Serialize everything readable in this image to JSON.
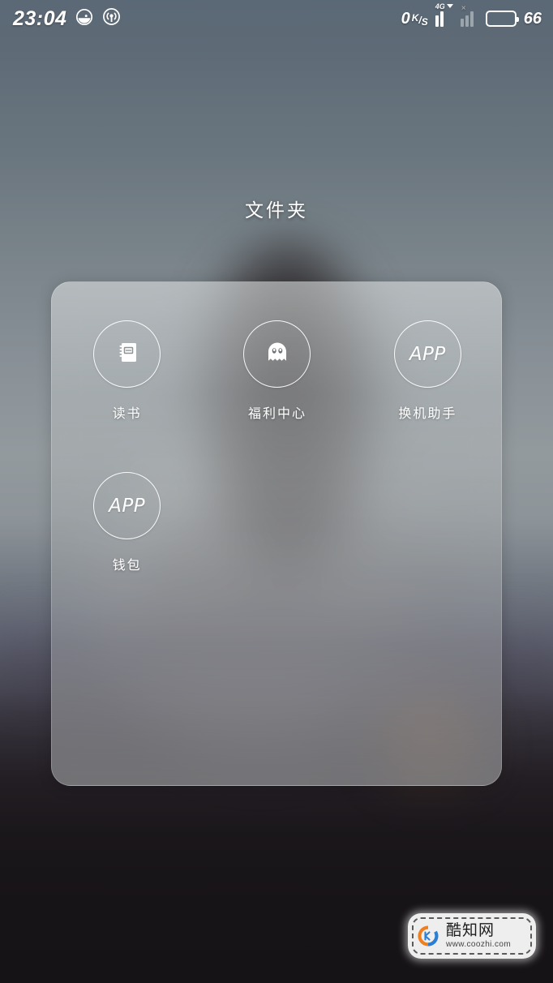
{
  "status_bar": {
    "time": "23:04",
    "icons": [
      {
        "name": "dnd-icon",
        "glyph": "do-not-disturb"
      },
      {
        "name": "hotspot-icon",
        "glyph": "personal-hotspot"
      }
    ],
    "network_speed": {
      "value": "0",
      "unit_top": "K",
      "unit_slash": "/",
      "unit_bottom": "S"
    },
    "sim1": {
      "label": "4G",
      "bars": 4
    },
    "sim2": {
      "label": "×",
      "bars": 4
    },
    "battery_percent": "66",
    "battery_level": 66
  },
  "folder": {
    "title": "文件夹",
    "apps": [
      {
        "label": "读书",
        "icon": "notebook-icon",
        "icon_type": "glyph",
        "text": ""
      },
      {
        "label": "福利中心",
        "icon": "ghost-icon",
        "icon_type": "glyph",
        "text": ""
      },
      {
        "label": "换机助手",
        "icon": "app-placeholder-icon",
        "icon_type": "text",
        "text": "APP"
      },
      {
        "label": "钱包",
        "icon": "app-placeholder-icon",
        "icon_type": "text",
        "text": "APP"
      }
    ]
  },
  "watermark": {
    "site_name": "酷知网",
    "url": "www.coozhi.com",
    "logo_colors": {
      "orange": "#ef8021",
      "blue": "#2a7fd4"
    }
  },
  "theme": {
    "accent_white": "#ffffff",
    "panel_tint": "#b4b7b8",
    "bg_top": "#5b6875",
    "bg_mid": "#939a9e",
    "bg_bottom": "#191619"
  }
}
